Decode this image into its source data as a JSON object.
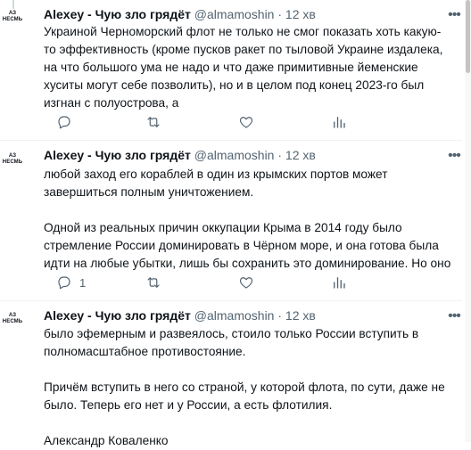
{
  "tweets": [
    {
      "avatar_line1": "АЗ",
      "avatar_line2": "НЕСМЬ",
      "name": "Alexey - Чую зло грядёт",
      "handle": "@almamoshin",
      "dot": "·",
      "time": "12 хв",
      "lines": [
        "Украиной Черноморский флот не только не смог показать хоть какую-",
        "то эффективность (кроме пусков ракет по тыловой Украине издалека,",
        "на что большого ума не надо и что даже примитивные йеменские",
        "хуситы могут себе позволить), но и в целом под конец 2023-го был",
        "изгнан с полуострова, а"
      ]
    },
    {
      "avatar_line1": "АЗ",
      "avatar_line2": "НЕСМЬ",
      "name": "Alexey - Чую зло грядёт",
      "handle": "@almamoshin",
      "dot": "·",
      "time": "12 хв",
      "lines": [
        "любой заход его кораблей в один из крымских портов может",
        "завершиться полным уничтожением.",
        "",
        "Одной из реальных причин оккупации Крыма в 2014 году было",
        "стремление России доминировать в Чёрном море, и она готова была",
        "идти на любые убытки, лишь бы сохранить это доминирование. Но оно"
      ],
      "reply_count": "1"
    },
    {
      "avatar_line1": "АЗ",
      "avatar_line2": "НЕСМЬ",
      "name": "Alexey - Чую зло грядёт",
      "handle": "@almamoshin",
      "dot": "·",
      "time": "12 хв",
      "lines": [
        "было эфемерным и развеялось, стоило только России вступить в",
        "полномасштабное противостояние.",
        "",
        "Причём вступить в него со страной, у которой флота, по сути, даже не",
        "было. Теперь его нет и у России, а есть флотилия.",
        "",
        "Александр Коваленко"
      ]
    }
  ],
  "icons": {
    "more": "more-horizontal-icon",
    "reply": "reply-icon",
    "retweet": "retweet-icon",
    "like": "like-icon",
    "views": "views-icon"
  },
  "colors": {
    "text": "#0f1419",
    "secondary": "#536471",
    "divider": "#eff3f4",
    "rail": "#cfd9de"
  }
}
